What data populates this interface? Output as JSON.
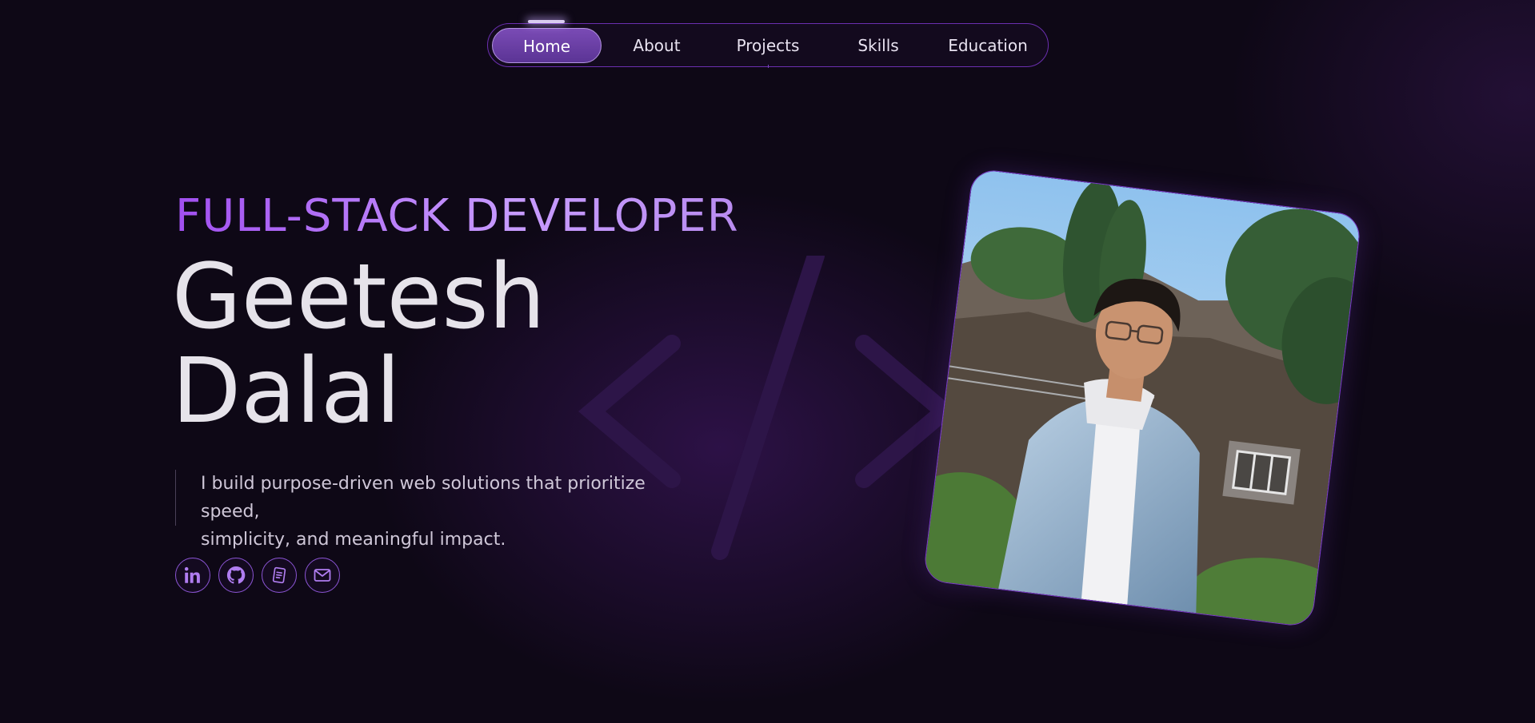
{
  "nav": {
    "items": [
      {
        "label": "Home",
        "active": true
      },
      {
        "label": "About",
        "active": false
      },
      {
        "label": "Projects",
        "active": false
      },
      {
        "label": "Skills",
        "active": false
      },
      {
        "label": "Education",
        "active": false
      }
    ]
  },
  "hero": {
    "role": "FULL-STACK DEVELOPER",
    "first_name": "Geetesh",
    "last_name": "Dalal",
    "tagline_line1": "I build purpose-driven web solutions that prioritize speed,",
    "tagline_line2": "simplicity, and meaningful impact."
  },
  "socials": [
    {
      "icon": "linkedin-icon"
    },
    {
      "icon": "github-icon"
    },
    {
      "icon": "resume-icon"
    },
    {
      "icon": "mail-icon"
    }
  ],
  "theme": {
    "background": "#0e0816",
    "accent": "#a14ff0",
    "accent_light": "#c79bff",
    "nav_active": "#6b3fa3",
    "text": "#e6e3ea"
  },
  "photo": {
    "subject": "profile-photo"
  }
}
